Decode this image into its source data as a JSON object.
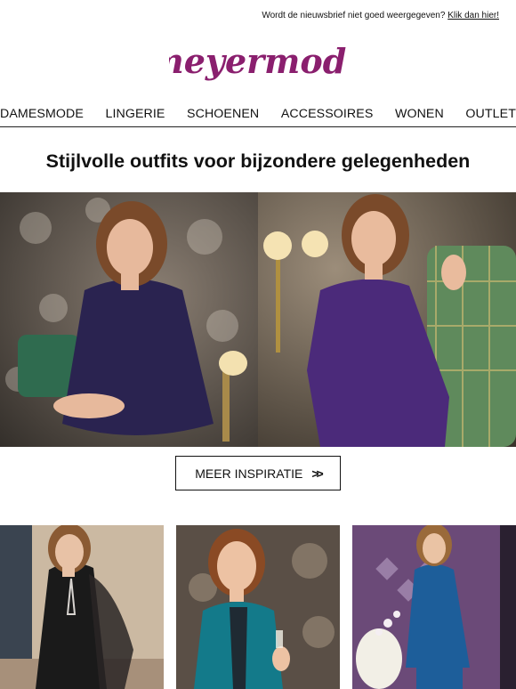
{
  "topbar": {
    "text": "Wordt de nieuwsbrief niet goed weergegeven?",
    "link": "Klik dan hier!"
  },
  "brand": {
    "logo_text": "meyermode",
    "color": "#8a1f6e"
  },
  "nav": {
    "items": [
      "DAMESMODE",
      "LINGERIE",
      "SCHOENEN",
      "ACCESSOIRES",
      "WONEN",
      "OUTLET"
    ]
  },
  "headline": "Stijlvolle outfits voor bijzondere gelegenheden",
  "cta": {
    "label": "MEER INSPIRATIE",
    "icon": "double-chevron-right-icon"
  },
  "colors": {
    "dress_navy": "#2a2350",
    "top_purple": "#4b2a7a",
    "teal_jacket": "#137a8a",
    "blue_outfit": "#1d5e9a"
  }
}
